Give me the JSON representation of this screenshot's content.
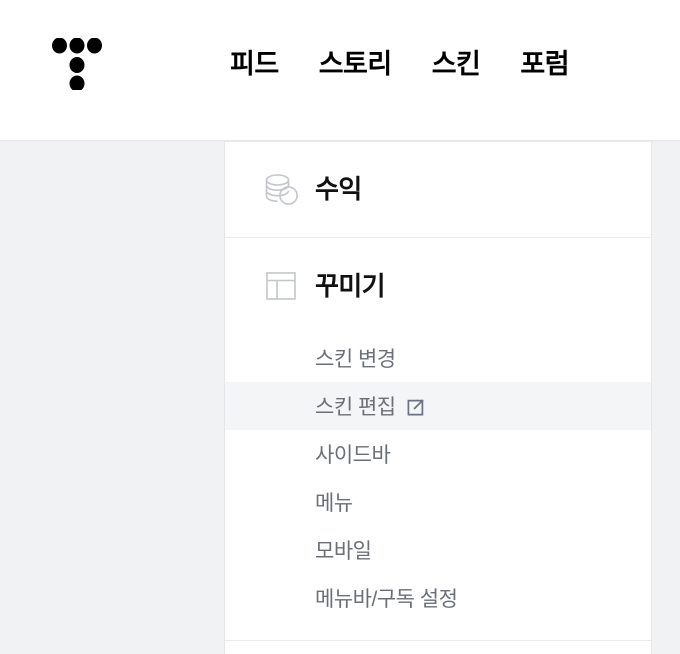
{
  "header": {
    "logo_name": "tistory-dots-logo",
    "nav": [
      {
        "label": "피드",
        "name": "nav-feed"
      },
      {
        "label": "스토리",
        "name": "nav-story"
      },
      {
        "label": "스킨",
        "name": "nav-skin"
      },
      {
        "label": "포럼",
        "name": "nav-forum"
      }
    ]
  },
  "sidebar": {
    "sections": [
      {
        "title": "수익",
        "icon": "coins-icon",
        "items": []
      },
      {
        "title": "꾸미기",
        "icon": "layout-template-icon",
        "items": [
          {
            "label": "스킨 변경",
            "selected": false,
            "external": false
          },
          {
            "label": "스킨 편집",
            "selected": true,
            "external": true
          },
          {
            "label": "사이드바",
            "selected": false,
            "external": false
          },
          {
            "label": "메뉴",
            "selected": false,
            "external": false
          },
          {
            "label": "모바일",
            "selected": false,
            "external": false
          },
          {
            "label": "메뉴바/구독 설정",
            "selected": false,
            "external": false
          }
        ]
      }
    ]
  },
  "colors": {
    "page_background": "#f1f2f4",
    "panel_background": "#ffffff",
    "border": "#e4e6ea",
    "divider": "#e9ebee",
    "selected_row": "#f3f5f7",
    "title_text": "#111111",
    "submenu_text": "#6b6f76",
    "icon_stroke": "#c3c6cb",
    "external_icon": "#6b7280"
  }
}
